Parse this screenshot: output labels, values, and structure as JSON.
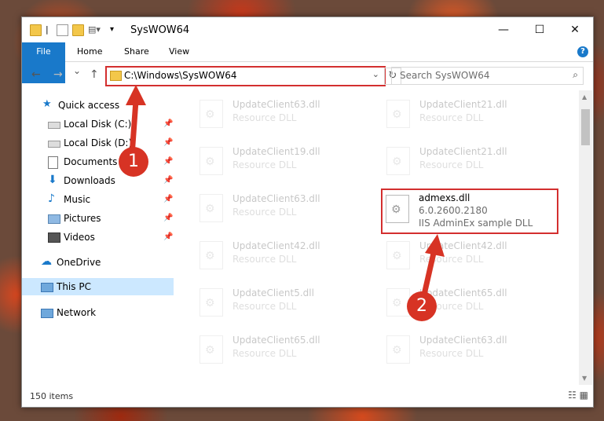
{
  "window": {
    "title": "SysWOW64"
  },
  "titlebar_buttons": {
    "minimize": "—",
    "maximize": "☐",
    "close": "✕"
  },
  "ribbon": {
    "file": "File",
    "home": "Home",
    "share": "Share",
    "view": "View",
    "help": "?"
  },
  "navigation": {
    "back": "←",
    "forward": "→",
    "recent": "⌄",
    "up": "↑"
  },
  "address": {
    "path": "C:\\Windows\\SysWOW64",
    "dropdown": "⌄",
    "refresh": "↻"
  },
  "search": {
    "placeholder": "Search SysWOW64",
    "icon": "⌕"
  },
  "sidebar": {
    "quick_access": "Quick access",
    "items": [
      {
        "label": "Local Disk (C:)",
        "icon": "drive-icon"
      },
      {
        "label": "Local Disk (D:)",
        "icon": "drive-icon"
      },
      {
        "label": "Documents",
        "icon": "documents-icon"
      },
      {
        "label": "Downloads",
        "icon": "downloads-icon"
      },
      {
        "label": "Music",
        "icon": "music-icon"
      },
      {
        "label": "Pictures",
        "icon": "pictures-icon"
      },
      {
        "label": "Videos",
        "icon": "videos-icon"
      }
    ],
    "onedrive": "OneDrive",
    "thispc": "This PC",
    "network": "Network",
    "pin": "📌"
  },
  "files": [
    {
      "name": "UpdateClient63.dll",
      "sub": "Resource DLL"
    },
    {
      "name": "UpdateClient21.dll",
      "sub": "Resource DLL"
    },
    {
      "name": "UpdateClient19.dll",
      "sub": "Resource DLL"
    },
    {
      "name": "UpdateClient21.dll",
      "sub": "Resource DLL"
    },
    {
      "name": "UpdateClient63.dll",
      "sub": "Resource DLL"
    },
    {
      "name": "admexs.dll",
      "version": "6.0.2600.2180",
      "sub": "IIS AdminEx sample DLL"
    },
    {
      "name": "UpdateClient42.dll",
      "sub": "Resource DLL"
    },
    {
      "name": "UpdateClient42.dll",
      "sub": "Resource DLL"
    },
    {
      "name": "UpdateClient5.dll",
      "sub": "Resource DLL"
    },
    {
      "name": "UpdateClient65.dll",
      "sub": "Resource DLL"
    },
    {
      "name": "UpdateClient65.dll",
      "sub": "Resource DLL"
    },
    {
      "name": "UpdateClient63.dll",
      "sub": "Resource DLL"
    }
  ],
  "status": {
    "count": "150 items",
    "views": "☷ ▦"
  },
  "annotations": {
    "step1": "1",
    "step2": "2"
  },
  "colors": {
    "accent": "#1979ca",
    "highlight": "#d32f2f",
    "selection": "#cce8ff"
  }
}
